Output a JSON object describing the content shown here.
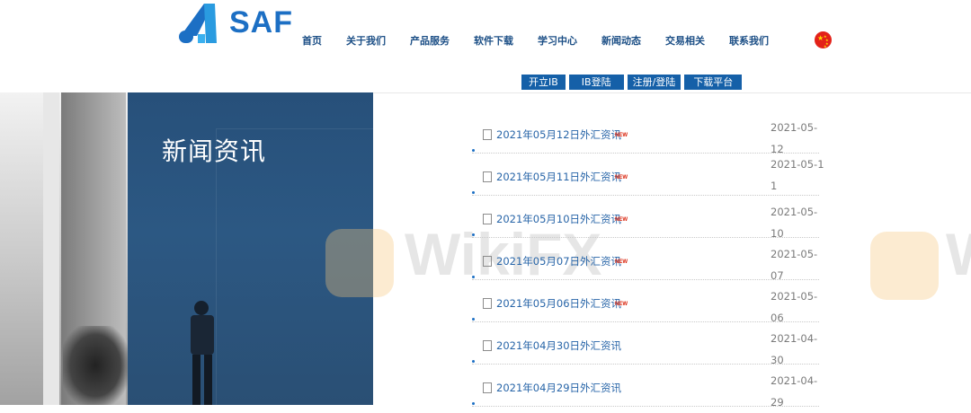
{
  "header": {
    "logo_text": "SAF",
    "nav": [
      "首页",
      "关于我们",
      "产品服务",
      "软件下载",
      "学习中心",
      "新闻动态",
      "交易相关",
      "联系我们"
    ],
    "subnav": [
      "开立IB",
      "IB登陆",
      "注册/登陆",
      "下载平台"
    ],
    "flag_icon": "china-flag-icon"
  },
  "banner": {
    "title": "新闻资讯"
  },
  "news": [
    {
      "title": "2021年05月12日外汇资讯",
      "badge": "NEW",
      "date": "2021-05-12"
    },
    {
      "title": "2021年05月11日外汇资讯",
      "badge": "NEW",
      "date": "2021-05-11"
    },
    {
      "title": "2021年05月10日外汇资讯",
      "badge": "NEW",
      "date": "2021-05-10"
    },
    {
      "title": "2021年05月07日外汇资讯",
      "badge": "NEW",
      "date": "2021-05-07"
    },
    {
      "title": "2021年05月06日外汇资讯",
      "badge": "NEW",
      "date": "2021-05-06"
    },
    {
      "title": "2021年04月30日外汇资讯",
      "badge": "",
      "date": "2021-04-30"
    },
    {
      "title": "2021年04月29日外汇资讯",
      "badge": "",
      "date": "2021-04-29"
    }
  ],
  "watermark": "WikiFX",
  "colors": {
    "brand": "#1c6fc4",
    "nav_text": "#1c4f86",
    "button_bg": "#1560a8",
    "badge": "#d81e06"
  }
}
